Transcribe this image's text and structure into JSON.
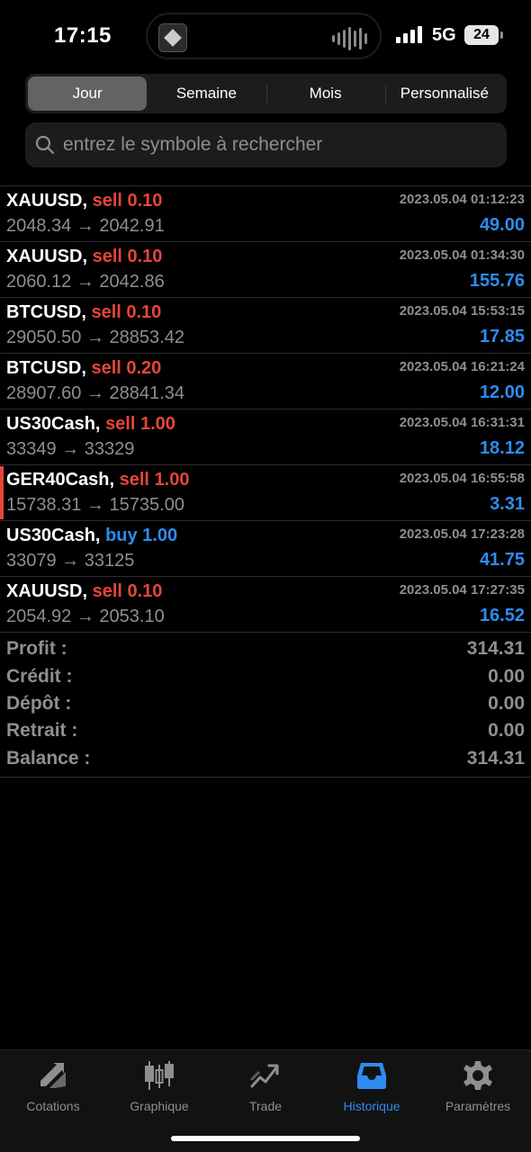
{
  "status": {
    "time": "17:15",
    "network": "5G",
    "battery": "24"
  },
  "tabs_period": [
    {
      "label": "Jour",
      "active": true
    },
    {
      "label": "Semaine",
      "active": false
    },
    {
      "label": "Mois",
      "active": false
    },
    {
      "label": "Personnalisé",
      "active": false
    }
  ],
  "search": {
    "placeholder": "entrez le symbole à rechercher",
    "value": ""
  },
  "trades": [
    {
      "symbol": "XAUUSD,",
      "side": "sell 0.10",
      "type": "sell",
      "date": "2023.05.04 01:12:23",
      "prices": "2048.34 → 2042.91",
      "profit": "49.00",
      "marked": false
    },
    {
      "symbol": "XAUUSD,",
      "side": "sell 0.10",
      "type": "sell",
      "date": "2023.05.04 01:34:30",
      "prices": "2060.12 → 2042.86",
      "profit": "155.76",
      "marked": false
    },
    {
      "symbol": "BTCUSD,",
      "side": "sell 0.10",
      "type": "sell",
      "date": "2023.05.04 15:53:15",
      "prices": "29050.50 → 28853.42",
      "profit": "17.85",
      "marked": false
    },
    {
      "symbol": "BTCUSD,",
      "side": "sell 0.20",
      "type": "sell",
      "date": "2023.05.04 16:21:24",
      "prices": "28907.60 → 28841.34",
      "profit": "12.00",
      "marked": false
    },
    {
      "symbol": "US30Cash,",
      "side": "sell 1.00",
      "type": "sell",
      "date": "2023.05.04 16:31:31",
      "prices": "33349 → 33329",
      "profit": "18.12",
      "marked": false
    },
    {
      "symbol": "GER40Cash,",
      "side": "sell 1.00",
      "type": "sell",
      "date": "2023.05.04 16:55:58",
      "prices": "15738.31 → 15735.00",
      "profit": "3.31",
      "marked": true
    },
    {
      "symbol": "US30Cash,",
      "side": "buy 1.00",
      "type": "buy",
      "date": "2023.05.04 17:23:28",
      "prices": "33079 → 33125",
      "profit": "41.75",
      "marked": false
    },
    {
      "symbol": "XAUUSD,",
      "side": "sell 0.10",
      "type": "sell",
      "date": "2023.05.04 17:27:35",
      "prices": "2054.92 → 2053.10",
      "profit": "16.52",
      "marked": false
    }
  ],
  "summary": [
    {
      "label": "Profit :",
      "value": "314.31"
    },
    {
      "label": "Crédit :",
      "value": "0.00"
    },
    {
      "label": "Dépôt :",
      "value": "0.00"
    },
    {
      "label": "Retrait :",
      "value": "0.00"
    },
    {
      "label": "Balance :",
      "value": "314.31"
    }
  ],
  "tabbar": [
    {
      "label": "Cotations",
      "icon": "arrows-exchange-icon",
      "active": false
    },
    {
      "label": "Graphique",
      "icon": "candlestick-chart-icon",
      "active": false
    },
    {
      "label": "Trade",
      "icon": "trend-chart-icon",
      "active": false
    },
    {
      "label": "Historique",
      "icon": "inbox-tray-icon",
      "active": true
    },
    {
      "label": "Paramètres",
      "icon": "gear-icon",
      "active": false
    }
  ],
  "colors": {
    "sell": "#e5453a",
    "buy": "#2f8cf0",
    "profit": "#2f8cf0",
    "muted": "#8e8e93",
    "active_tab": "#2f8cf0"
  }
}
